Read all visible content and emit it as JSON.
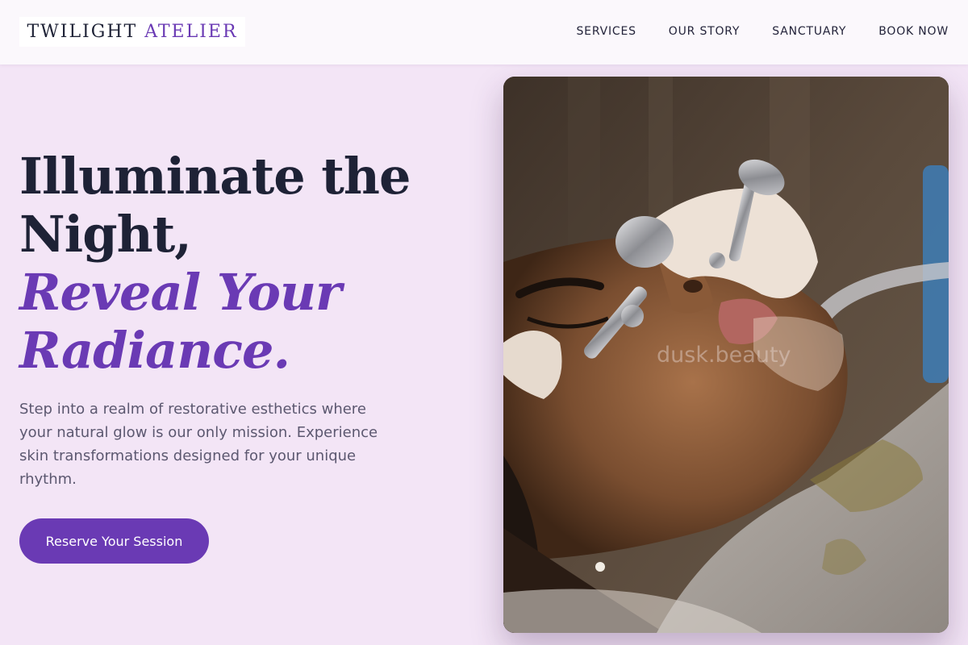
{
  "brand": {
    "name_primary": "TWILIGHT",
    "name_accent": "ATELIER"
  },
  "nav": {
    "items": [
      {
        "label": "SERVICES"
      },
      {
        "label": "OUR STORY"
      },
      {
        "label": "SANCTUARY"
      },
      {
        "label": "BOOK NOW"
      }
    ]
  },
  "hero": {
    "title_line1": "Illuminate the",
    "title_line2": "Night,",
    "title_italic_line1": "Reveal Your",
    "title_italic_line2": "Radiance.",
    "description": "Step into a realm of restorative esthetics where your natural glow is our only mission. Experience skin transformations designed for your unique rhythm.",
    "cta_label": "Reserve Your Session",
    "image_watermark": "dusk.beauty"
  },
  "colors": {
    "page_background": "#f3e5f6",
    "header_background": "#fbf8fc",
    "accent": "#6a3ab4",
    "heading_text": "#1e2236",
    "body_text": "#5c5870"
  }
}
